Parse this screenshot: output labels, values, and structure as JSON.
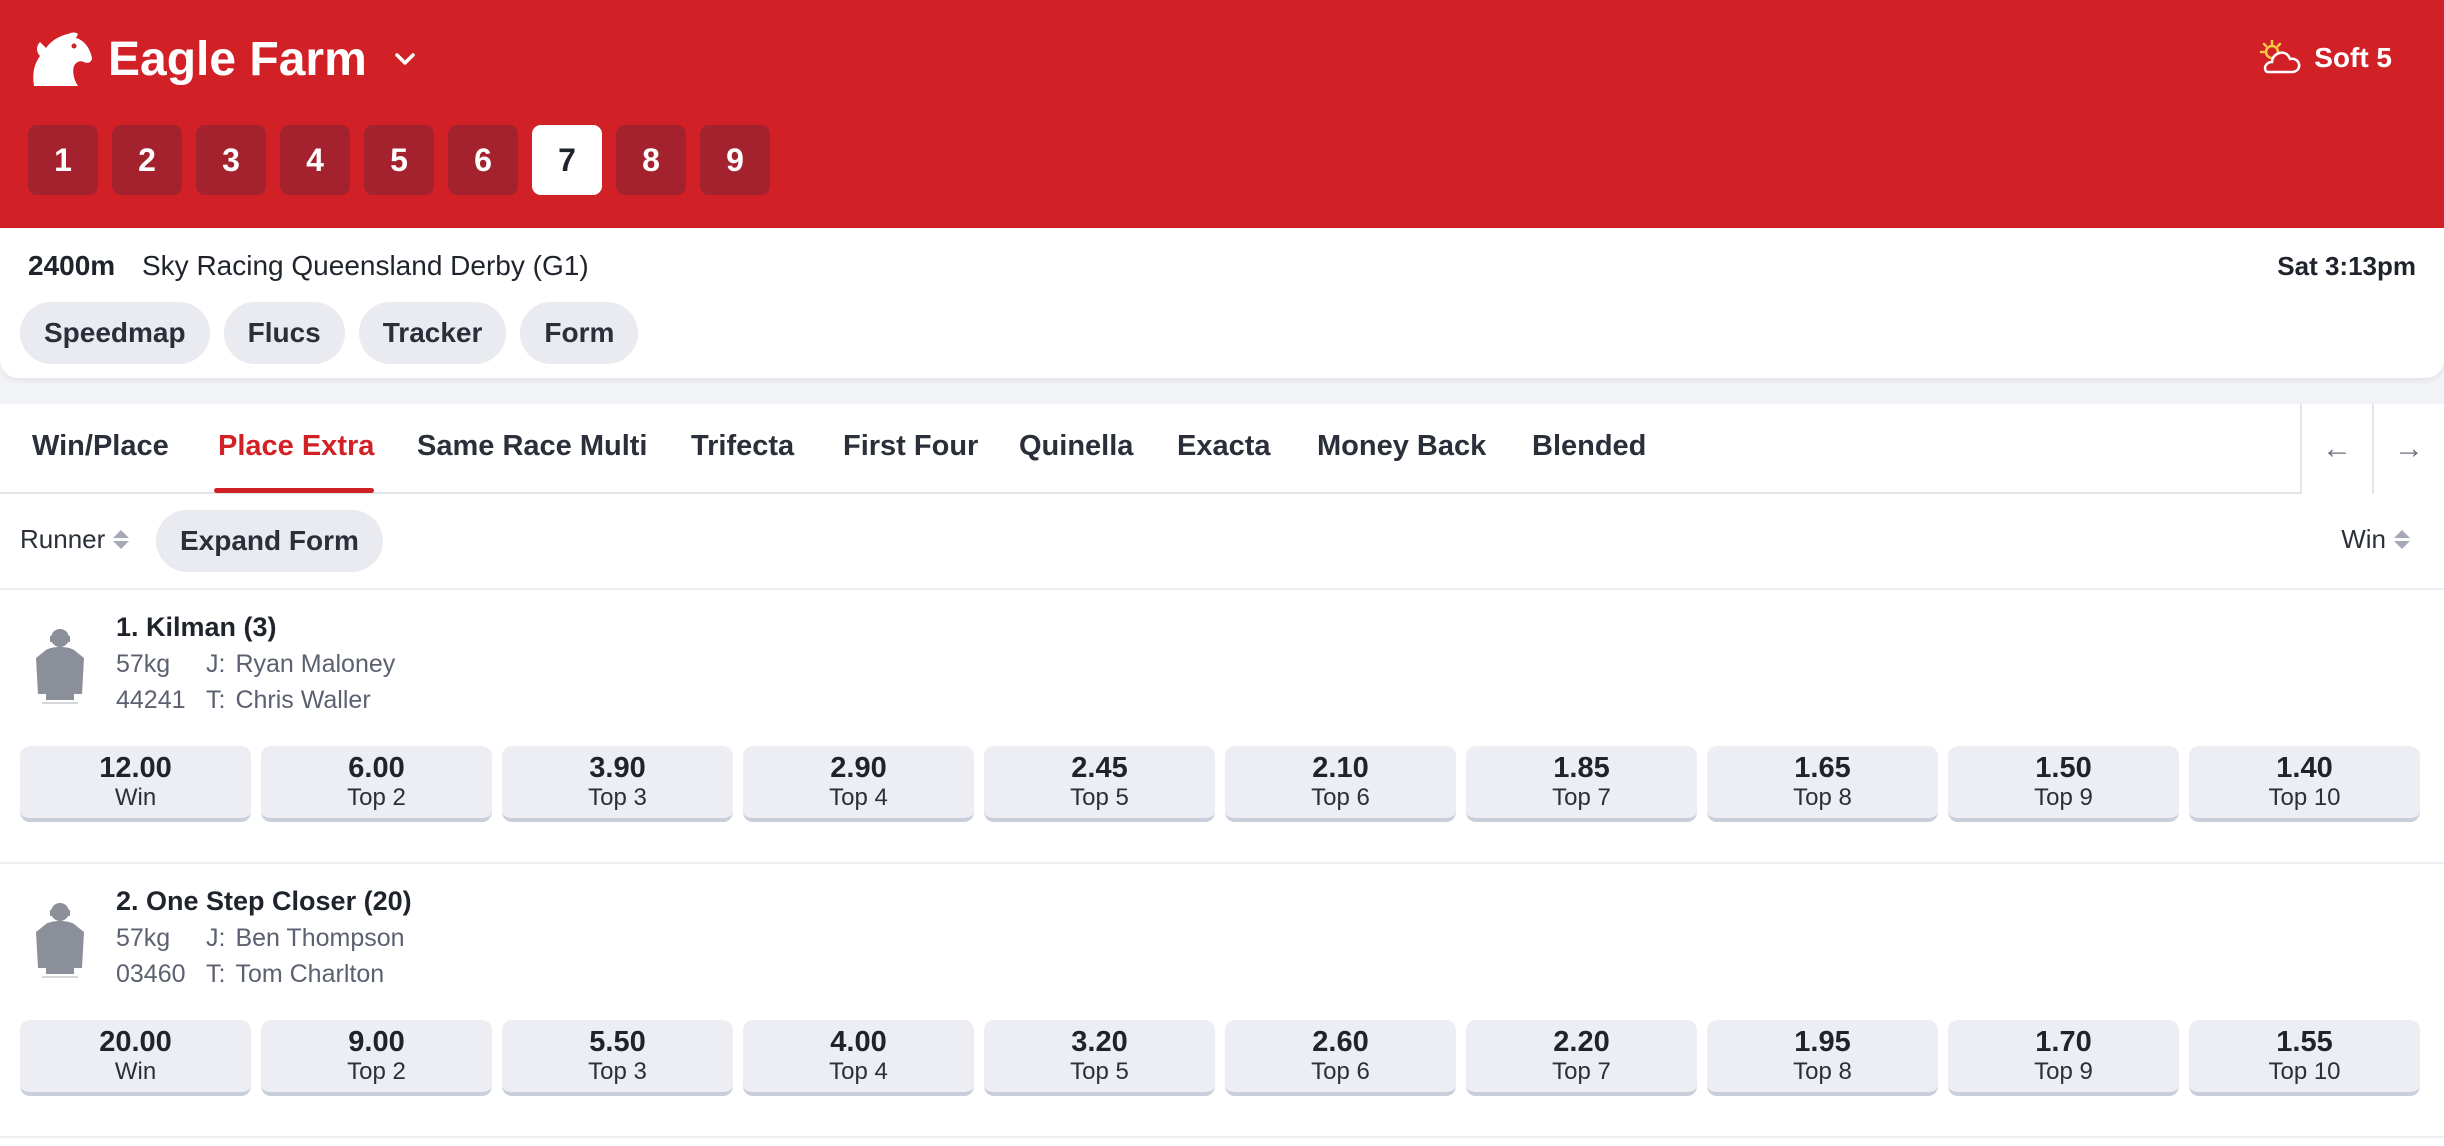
{
  "header": {
    "track": "Eagle Farm",
    "icons": {
      "logo": "horse-head-icon",
      "chevron": "chevron-down-icon",
      "weather": "partly-cloudy-icon"
    },
    "weather": "Soft 5",
    "races": [
      "1",
      "2",
      "3",
      "4",
      "5",
      "6",
      "7",
      "8",
      "9"
    ],
    "active_race": "7"
  },
  "race": {
    "distance": "2400m",
    "name": "Sky Racing Queensland Derby (G1)",
    "time": "Sat 3:13pm",
    "pills": [
      "Speedmap",
      "Flucs",
      "Tracker",
      "Form"
    ]
  },
  "bet_tabs": {
    "tabs": [
      "Win/Place",
      "Place Extra",
      "Same Race Multi",
      "Trifecta",
      "First Four",
      "Quinella",
      "Exacta",
      "Money Back",
      "Blended"
    ],
    "active": "Place Extra",
    "prev_arrow": "←",
    "next_arrow": "→"
  },
  "sortbar": {
    "runner_label": "Runner",
    "expand_form": "Expand Form",
    "win_label": "Win"
  },
  "runners": [
    {
      "name": "1. Kilman (3)",
      "weight": "57kg",
      "jockey_label": "J:",
      "jockey": "Ryan Maloney",
      "form": "44241",
      "trainer_label": "T:",
      "trainer": "Chris Waller",
      "odds": [
        {
          "price": "12.00",
          "label": "Win"
        },
        {
          "price": "6.00",
          "label": "Top 2"
        },
        {
          "price": "3.90",
          "label": "Top 3"
        },
        {
          "price": "2.90",
          "label": "Top 4"
        },
        {
          "price": "2.45",
          "label": "Top 5"
        },
        {
          "price": "2.10",
          "label": "Top 6"
        },
        {
          "price": "1.85",
          "label": "Top 7"
        },
        {
          "price": "1.65",
          "label": "Top 8"
        },
        {
          "price": "1.50",
          "label": "Top 9"
        },
        {
          "price": "1.40",
          "label": "Top 10"
        }
      ]
    },
    {
      "name": "2. One Step Closer (20)",
      "weight": "57kg",
      "jockey_label": "J:",
      "jockey": "Ben Thompson",
      "form": "03460",
      "trainer_label": "T:",
      "trainer": "Tom Charlton",
      "odds": [
        {
          "price": "20.00",
          "label": "Win"
        },
        {
          "price": "9.00",
          "label": "Top 2"
        },
        {
          "price": "5.50",
          "label": "Top 3"
        },
        {
          "price": "4.00",
          "label": "Top 4"
        },
        {
          "price": "3.20",
          "label": "Top 5"
        },
        {
          "price": "2.60",
          "label": "Top 6"
        },
        {
          "price": "2.20",
          "label": "Top 7"
        },
        {
          "price": "1.95",
          "label": "Top 8"
        },
        {
          "price": "1.70",
          "label": "Top 9"
        },
        {
          "price": "1.55",
          "label": "Top 10"
        }
      ]
    }
  ],
  "colors": {
    "brand": "#d12126",
    "race_tile": "#a3222d"
  }
}
